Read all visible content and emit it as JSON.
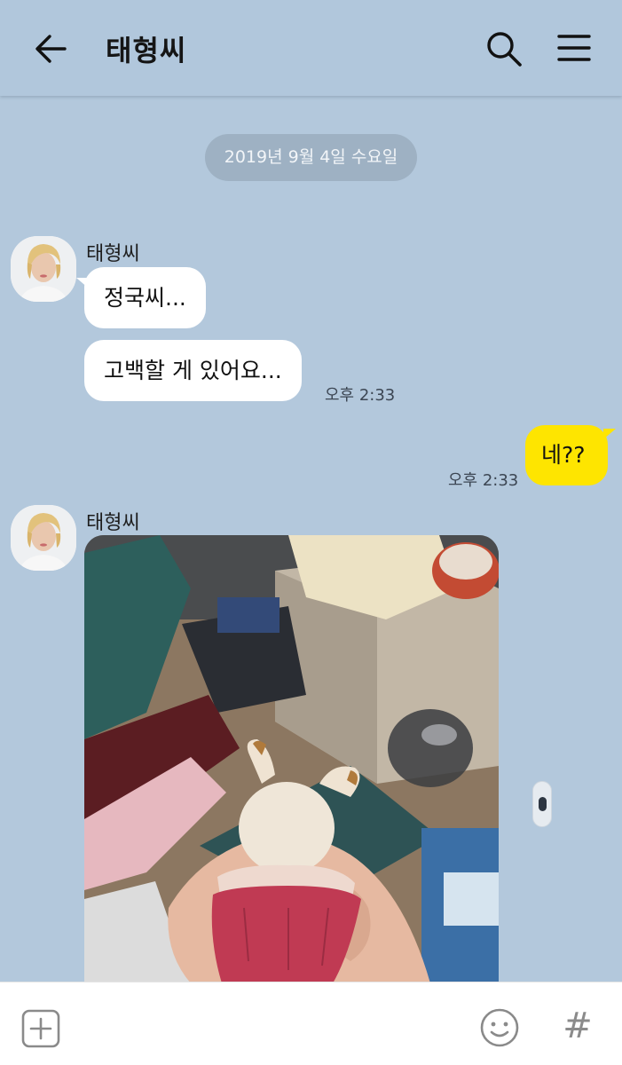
{
  "header": {
    "title": "태형씨"
  },
  "date_divider": "2019년 9월 4일 수요일",
  "messages": [
    {
      "sender": "태형씨",
      "lines": [
        "정국씨...",
        "고백할 게 있어요..."
      ],
      "time": "오후 2:33"
    },
    {
      "sender": "me",
      "text": "네??",
      "time": "오후 2:33"
    },
    {
      "sender": "태형씨",
      "type": "photo"
    }
  ],
  "icons": {
    "back": "arrow-left-icon",
    "search": "search-icon",
    "menu": "hamburger-menu-icon",
    "attach": "plus-square-icon",
    "emoji": "smiley-icon",
    "hashtag": "hash-icon"
  },
  "input_bar": {
    "hashtag_glyph": "#"
  },
  "colors": {
    "chat_background": "#b3c8dc",
    "my_bubble": "#fee500",
    "their_bubble": "#ffffff",
    "date_pill": "#9eb1c3"
  }
}
